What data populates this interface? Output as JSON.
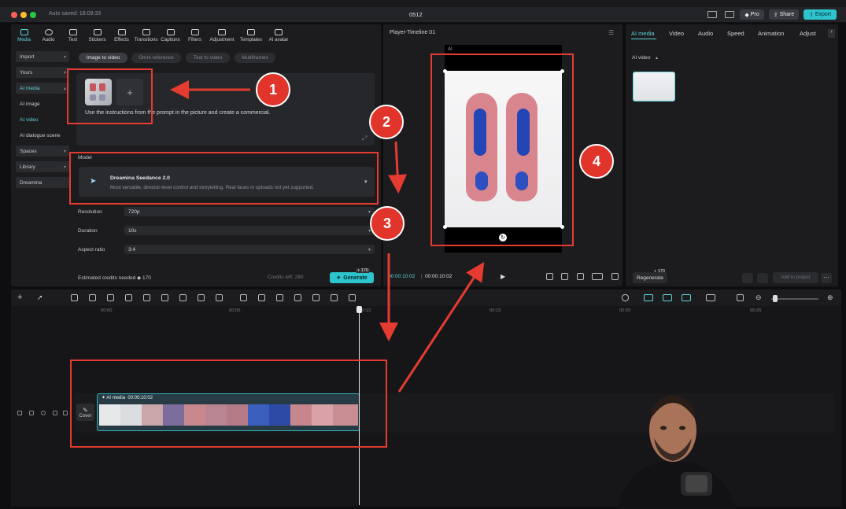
{
  "titlebar": {
    "autosave": "Auto saved: 18:09:33",
    "project_title": "0512",
    "pro_label": "Pro",
    "share_label": "Share",
    "export_label": "Export"
  },
  "toolbar": {
    "items": [
      {
        "label": "Media",
        "icon": "media-icon"
      },
      {
        "label": "Audio",
        "icon": "audio-icon"
      },
      {
        "label": "Text",
        "icon": "text-icon"
      },
      {
        "label": "Stickers",
        "icon": "stickers-icon"
      },
      {
        "label": "Effects",
        "icon": "effects-icon"
      },
      {
        "label": "Transitions",
        "icon": "transitions-icon"
      },
      {
        "label": "Captions",
        "icon": "captions-icon"
      },
      {
        "label": "Filters",
        "icon": "filters-icon"
      },
      {
        "label": "Adjustment",
        "icon": "adjustment-icon"
      },
      {
        "label": "Templates",
        "icon": "templates-icon"
      },
      {
        "label": "AI avatar",
        "icon": "ai-avatar-icon"
      }
    ]
  },
  "sidebar": {
    "items": [
      {
        "label": "Import"
      },
      {
        "label": "Yours"
      },
      {
        "label": "AI media"
      },
      {
        "label": "AI image"
      },
      {
        "label": "AI video"
      },
      {
        "label": "AI dialogue scene"
      },
      {
        "label": "Spaces"
      },
      {
        "label": "Library"
      },
      {
        "label": "Dreamina"
      }
    ]
  },
  "modes": [
    "Image to video",
    "Omni reference",
    "Text to video",
    "Multiframes"
  ],
  "prompt": {
    "text": "Use the instructions from the prompt in the picture and create a commercial.",
    "add_symbol": "+"
  },
  "model": {
    "section_label": "Model",
    "name": "Dreamina Seedance 2.0",
    "description": "Most versatile, director-level control and storytelling. Real faces in uploads not yet supported."
  },
  "settings": {
    "resolution": {
      "label": "Resolution",
      "value": "720p"
    },
    "duration": {
      "label": "Duration",
      "value": "10s"
    },
    "aspect_ratio": {
      "label": "Aspect ratio",
      "value": "3:4"
    }
  },
  "generate": {
    "credits_needed": "Estimated credits needed",
    "credits_value": "170",
    "credits_left": "Credits left: 280",
    "button_label": "Generate",
    "badge": "+ 170"
  },
  "player": {
    "title": "Player-Timeline 01",
    "ai_tag": "AI",
    "current_time": "00:00:10:02",
    "total_time": "00:00:10:02"
  },
  "right_panel": {
    "tabs": [
      "AI media",
      "Video",
      "Audio",
      "Speed",
      "Animation",
      "Adjust"
    ],
    "section": "AI video",
    "regenerate_label": "Regenerate",
    "regenerate_badge": "+ 170",
    "add_label": "Add to project"
  },
  "timeline": {
    "ruler": [
      "00:00",
      "00:05",
      "00:10",
      "00:15",
      "00:20",
      "00:25"
    ],
    "clip_label": "AI media",
    "clip_duration": "00:00:10:02",
    "cover_label": "Cover"
  },
  "annotations": [
    "1",
    "2",
    "3",
    "4"
  ],
  "colors": {
    "accent": "#2ec4cd",
    "annotation_red": "#e53b30"
  }
}
